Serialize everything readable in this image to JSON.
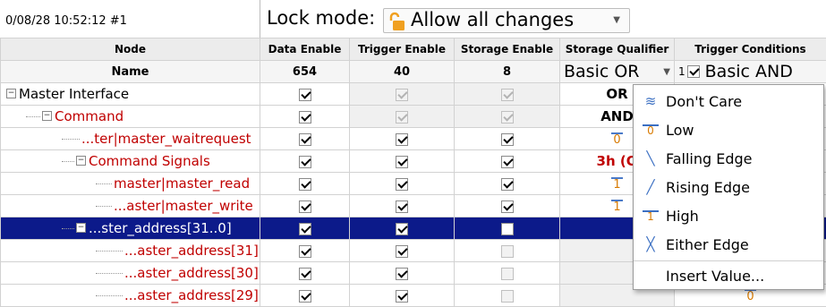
{
  "toolbar": {
    "timestamp": "0/08/28 10:52:12 #1",
    "lock_mode_label": "Lock mode:",
    "lock_mode_value": "Allow all changes"
  },
  "headers": {
    "node": "Node",
    "data_enable": "Data Enable",
    "trigger_enable": "Trigger Enable",
    "storage_enable": "Storage Enable",
    "storage_qualifier": "Storage Qualifier",
    "trigger_conditions": "Trigger Conditions"
  },
  "subheaders": {
    "name": "Name",
    "data_enable_count": "654",
    "trigger_enable_count": "40",
    "storage_enable_count": "8",
    "storage_qualifier_value": "Basic OR",
    "trigger_conditions_index": "1",
    "trigger_conditions_value": "Basic AND"
  },
  "rows": [
    {
      "name": "Master Interface",
      "color": "#000000",
      "data": true,
      "trigger": true,
      "storage": true,
      "trigger_dim": true,
      "storage_dim": true,
      "qualifier": "OR"
    },
    {
      "name": "Command",
      "color": "#c00000",
      "data": true,
      "trigger": true,
      "storage": true,
      "trigger_dim": true,
      "storage_dim": true,
      "qualifier": "AND"
    },
    {
      "name": "...ter|master_waitrequest",
      "color": "#c00000",
      "data": true,
      "trigger": true,
      "storage": true,
      "qualifier": "0"
    },
    {
      "name": "Command Signals",
      "color": "#c00000",
      "data": true,
      "trigger": true,
      "storage": true,
      "qualifier": "3h (O"
    },
    {
      "name": "master|master_read",
      "color": "#c00000",
      "data": true,
      "trigger": true,
      "storage": true,
      "qualifier": "1"
    },
    {
      "name": "...aster|master_write",
      "color": "#c00000",
      "data": true,
      "trigger": true,
      "storage": true,
      "qualifier": "1"
    },
    {
      "name": "...ster_address[31..0]",
      "color": "#ffffff",
      "data": true,
      "trigger": true,
      "storage": false,
      "qualifier": ""
    },
    {
      "name": "...aster_address[31]",
      "color": "#c00000",
      "data": true,
      "trigger": true,
      "storage": false,
      "qualifier": ""
    },
    {
      "name": "...aster_address[30]",
      "color": "#c00000",
      "data": true,
      "trigger": true,
      "storage": false,
      "qualifier": ""
    },
    {
      "name": "...aster_address[29]",
      "color": "#c00000",
      "data": true,
      "trigger": true,
      "storage": false,
      "qualifier": ""
    }
  ],
  "trigger_condition_cells": [
    "",
    "",
    "",
    "",
    "",
    "",
    "",
    "",
    "",
    "0"
  ],
  "menu": {
    "items": [
      {
        "label": "Don't Care",
        "icon": "dont-care-icon"
      },
      {
        "label": "Low",
        "icon": "low-icon"
      },
      {
        "label": "Falling Edge",
        "icon": "falling-edge-icon"
      },
      {
        "label": "Rising Edge",
        "icon": "rising-edge-icon"
      },
      {
        "label": "High",
        "icon": "high-icon"
      },
      {
        "label": "Either Edge",
        "icon": "either-edge-icon"
      }
    ],
    "insert_value": "Insert Value..."
  },
  "colors": {
    "selected_row": "#0c1a8a",
    "signal_red": "#c00000",
    "edge_blue": "#3b6fc2",
    "lock_orange": "#f0a020"
  }
}
